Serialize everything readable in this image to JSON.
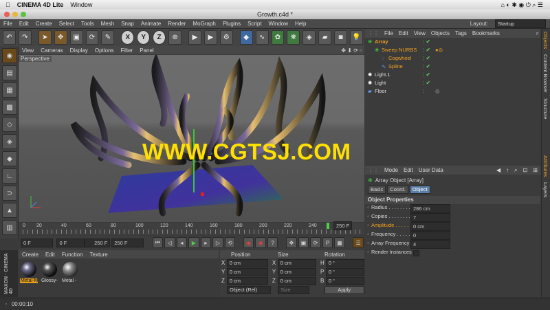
{
  "mac_menu": {
    "apple": "",
    "app": "CINEMA 4D Lite",
    "window": "Window"
  },
  "window_title": "Growth.c4d *",
  "c4d_menu": [
    "File",
    "Edit",
    "Create",
    "Select",
    "Tools",
    "Mesh",
    "Snap",
    "Animate",
    "Render",
    "MoGraph",
    "Plugins",
    "Script",
    "Window",
    "Help"
  ],
  "layout": {
    "label": "Layout:",
    "value": "Startup"
  },
  "viewport": {
    "menu": [
      "View",
      "Cameras",
      "Display",
      "Options",
      "Filter",
      "Panel"
    ],
    "label": "Perspective"
  },
  "watermark": "WWW.CGTSJ.COM",
  "timeline": {
    "ticks": [
      "0",
      "20",
      "40",
      "60",
      "80",
      "100",
      "120",
      "140",
      "160",
      "180",
      "200",
      "220",
      "240"
    ],
    "end_field": "250 F"
  },
  "playback": {
    "start": "0 F",
    "current": "0 F",
    "min": "250 F",
    "max": "250 F"
  },
  "materials": {
    "menu": [
      "Create",
      "Edit",
      "Function",
      "Texture"
    ],
    "items": [
      "Metal-M",
      "Glossy-",
      "Metal -"
    ]
  },
  "coords": {
    "headers": [
      "Position",
      "Size",
      "Rotation"
    ],
    "rows": [
      {
        "axis": "X",
        "pos": "0 cm",
        "size_axis": "X",
        "size": "0 cm",
        "rot_axis": "H",
        "rot": "0 °"
      },
      {
        "axis": "Y",
        "pos": "0 cm",
        "size_axis": "Y",
        "size": "0 cm",
        "rot_axis": "P",
        "rot": "0 °"
      },
      {
        "axis": "Z",
        "pos": "0 cm",
        "size_axis": "Z",
        "size": "0 cm",
        "rot_axis": "B",
        "rot": "0 °"
      }
    ],
    "mode": "Object (Rel)",
    "size_mode": "Size",
    "apply": "Apply"
  },
  "status": "00:00:10",
  "objects": {
    "menu": [
      "File",
      "Edit",
      "View",
      "Objects",
      "Tags",
      "Bookmarks"
    ],
    "items": [
      {
        "name": "Array",
        "color": "#f0a020"
      },
      {
        "name": "Sweep NURBS",
        "color": "#f0a020"
      },
      {
        "name": "Cogwheel",
        "color": "#f0a020"
      },
      {
        "name": "Spline",
        "color": "#f0a020"
      },
      {
        "name": "Light.1",
        "color": "#e0e0e0"
      },
      {
        "name": "Light",
        "color": "#e0e0e0"
      },
      {
        "name": "Floor",
        "color": "#e0e0e0"
      }
    ]
  },
  "right_tabs": [
    "Objects",
    "Content Browser",
    "Structure",
    "Attributes",
    "Layers"
  ],
  "attributes": {
    "menu": [
      "Mode",
      "Edit",
      "User Data"
    ],
    "object_title": "Array Object [Array]",
    "tabs": [
      "Basic",
      "Coord.",
      "Object"
    ],
    "section": "Object Properties",
    "props": [
      {
        "label": "Radius . . . . . . . .",
        "value": "286 cm"
      },
      {
        "label": "Copies . . . . . . . .",
        "value": "7"
      },
      {
        "label": "Amplitude . . . . . .",
        "value": "0 cm"
      },
      {
        "label": "Frequency . . . . . .",
        "value": "0"
      },
      {
        "label": "Array Frequency",
        "value": "4"
      }
    ],
    "render_instances": "Render Instances"
  },
  "colors": {
    "accent": "#f0a020",
    "watermark": "#ffe000",
    "selected_tab": "#5a7fa8"
  }
}
